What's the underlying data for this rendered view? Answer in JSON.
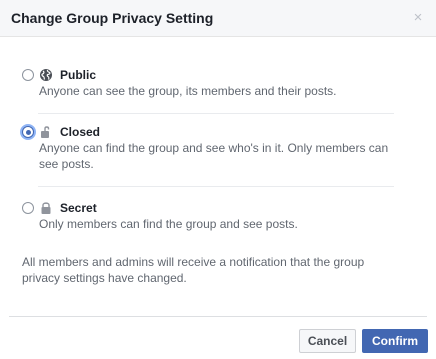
{
  "dialog": {
    "title": "Change Group Privacy Setting",
    "close_glyph": "×",
    "selected_option": "closed"
  },
  "options": [
    {
      "key": "public",
      "title": "Public",
      "icon": "globe-icon",
      "description": "Anyone can see the group, its members and their posts."
    },
    {
      "key": "closed",
      "title": "Closed",
      "icon": "unlock-icon",
      "description": "Anyone can find the group and see who's in it. Only members can see posts."
    },
    {
      "key": "secret",
      "title": "Secret",
      "icon": "lock-icon",
      "description": "Only members can find the group and see posts."
    }
  ],
  "notice": "All members and admins will receive a notification that the group privacy settings have changed.",
  "buttons": {
    "cancel_label": "Cancel",
    "confirm_label": "Confirm"
  },
  "colors": {
    "accent": "#4267b2",
    "header_bg": "#f6f7f9",
    "text_primary": "#1d2129",
    "text_secondary": "#616770"
  }
}
